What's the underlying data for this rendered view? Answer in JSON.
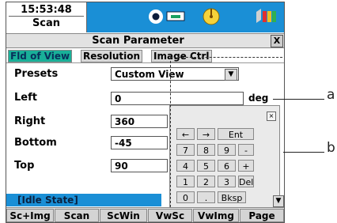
{
  "status_bar": {
    "time": "15:53:48",
    "mode": "Scan"
  },
  "dialog": {
    "title": "Scan Parameter",
    "close": "X"
  },
  "tabs": [
    {
      "label": "Fld of View",
      "active": true
    },
    {
      "label": "Resolution",
      "active": false
    },
    {
      "label": "Image Ctrl",
      "active": false
    }
  ],
  "form": {
    "presets": {
      "label": "Presets",
      "value": "Custom View"
    },
    "left": {
      "label": "Left",
      "value": "0",
      "unit": "deg"
    },
    "right": {
      "label": "Right",
      "value": "360"
    },
    "bottom": {
      "label": "Bottom",
      "value": "-45"
    },
    "top": {
      "label": "Top",
      "value": "90"
    }
  },
  "keypad": {
    "close": "×",
    "rows": [
      [
        "←",
        "→",
        "Ent"
      ],
      [
        "7",
        "8",
        "9",
        "-"
      ],
      [
        "4",
        "5",
        "6",
        "+"
      ],
      [
        "1",
        "2",
        "3",
        "Del"
      ],
      [
        "0",
        ".",
        "Bksp"
      ]
    ]
  },
  "status": {
    "text": "[Idle State]"
  },
  "softkeys": [
    "Sc+Img",
    "Scan",
    "ScWin",
    "VwSc",
    "VwImg",
    "Page"
  ],
  "annotations": {
    "a": "a",
    "b": "b"
  },
  "colors": {
    "accent_blue": "#1a8fd6",
    "active_tab": "#19b098"
  }
}
